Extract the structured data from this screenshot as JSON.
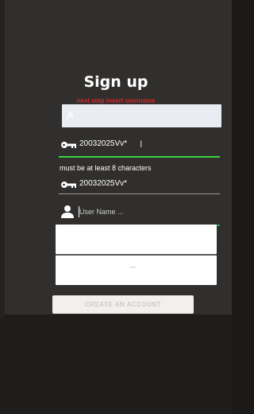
{
  "header": {
    "title": "Sign up",
    "hint": "next step insert username"
  },
  "form": {
    "email": {
      "value": ""
    },
    "password": {
      "value": "20032025Vv*"
    },
    "password_error": "must be at least 8 characters",
    "confirm_password": {
      "value": "20032025Vv*"
    },
    "username": {
      "placeholder": "User Name ..."
    },
    "extra_field_1": {
      "value": ""
    },
    "extra_field_2": {
      "value": ""
    },
    "create_button_label": "CREATE AN ACCOUNT"
  },
  "colors": {
    "background": "#302f2d",
    "hint": "#d7262a",
    "valid_underline": "#3bd23d",
    "focus_underline": "#29a35c"
  },
  "icons": [
    "key-icon",
    "user-icon"
  ]
}
